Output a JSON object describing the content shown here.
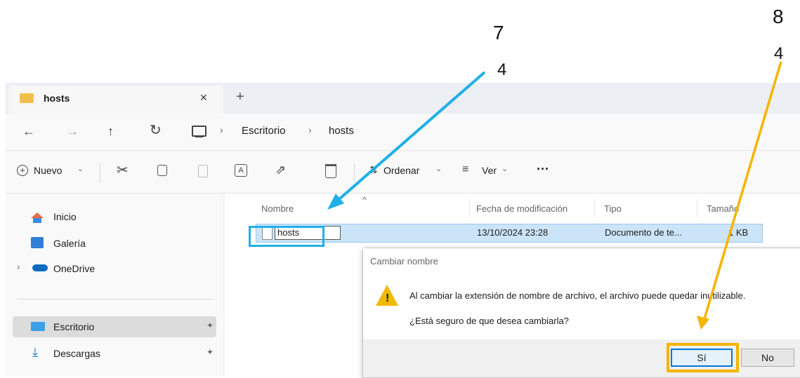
{
  "annotations": {
    "step7_num": "7",
    "step7_sub": "4",
    "step8_num": "8",
    "step8_sub": "4",
    "arrow_blue_color": "#1fb0e8",
    "arrow_yellow_color": "#f5b400"
  },
  "tab": {
    "title": "hosts",
    "close": "✕",
    "new_tab": "+"
  },
  "address": {
    "back": "←",
    "forward": "→",
    "up": "↑",
    "refresh": "↻",
    "crumbs": [
      "Escritorio",
      "hosts"
    ],
    "sep": "›"
  },
  "commandbar": {
    "new_label": "Nuevo",
    "sort_label": "Ordenar",
    "view_label": "Ver",
    "more": "···"
  },
  "nav": {
    "items": [
      {
        "label": "Inicio"
      },
      {
        "label": "Galería"
      },
      {
        "label": "OneDrive"
      },
      {
        "label": "Escritorio"
      },
      {
        "label": "Descargas"
      }
    ]
  },
  "columns": {
    "name": "Nombre",
    "modified": "Fecha de modificación",
    "type": "Tipo",
    "size": "Tamaño"
  },
  "file": {
    "name": "hosts",
    "modified": "13/10/2024 23:28",
    "type": "Documento de te...",
    "size": "1 KB"
  },
  "dialog": {
    "title": "Cambiar nombre",
    "message": "Al cambiar la extensión de nombre de archivo, el archivo puede quedar inutilizable.",
    "question": "¿Está seguro de que desea cambiarla?",
    "yes": "Sí",
    "no": "No"
  }
}
